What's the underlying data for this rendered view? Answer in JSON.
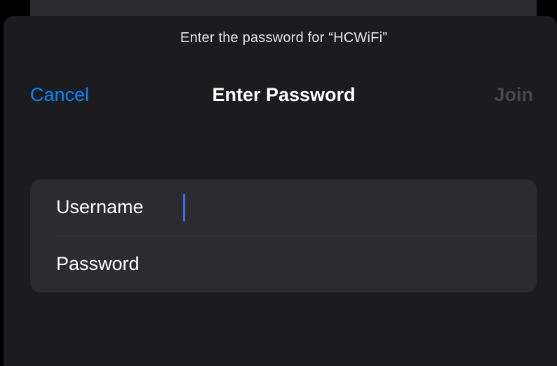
{
  "prompt": "Enter the password for “HCWiFi”",
  "nav": {
    "cancel_label": "Cancel",
    "title": "Enter Password",
    "join_label": "Join"
  },
  "form": {
    "username": {
      "label": "Username",
      "value": "",
      "placeholder": ""
    },
    "password": {
      "label": "Password",
      "value": "",
      "placeholder": ""
    }
  },
  "colors": {
    "accent": "#0a84ff",
    "disabled": "#48484a",
    "caret": "#3a6cf0",
    "sheet_background": "#1c1c1e",
    "group_background": "#2c2c2e"
  }
}
